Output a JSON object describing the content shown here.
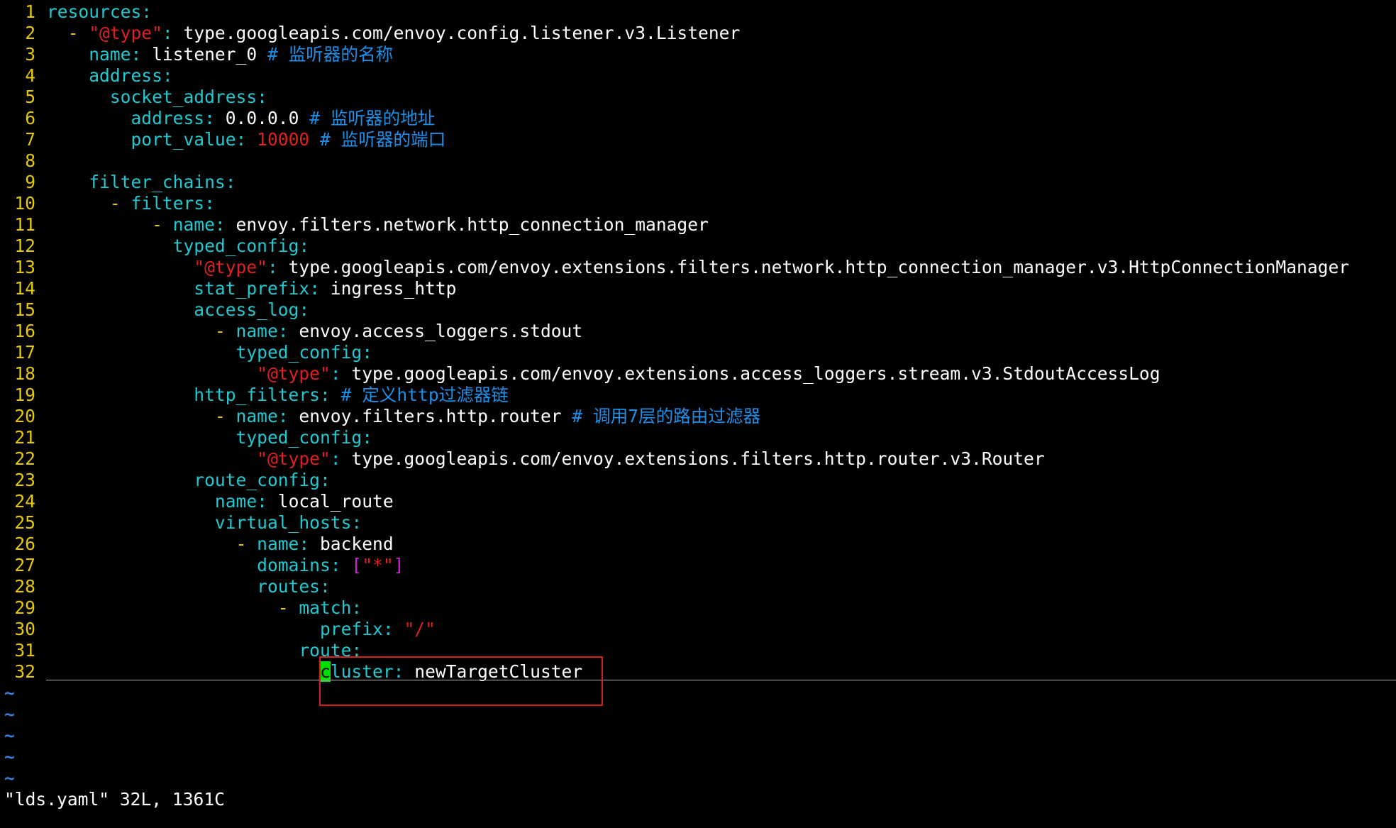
{
  "editor": {
    "lines": [
      {
        "num": "1",
        "parts": [
          {
            "t": "resources",
            "c": "key"
          },
          {
            "t": ":",
            "c": "punc"
          }
        ]
      },
      {
        "num": "2",
        "parts": [
          {
            "t": "  - ",
            "c": "dash"
          },
          {
            "t": "\"@type\"",
            "c": "str"
          },
          {
            "t": ": ",
            "c": "punc"
          },
          {
            "t": "type.googleapis.com/envoy.config.listener.v3.Listener",
            "c": "val"
          }
        ]
      },
      {
        "num": "3",
        "parts": [
          {
            "t": "    name",
            "c": "key"
          },
          {
            "t": ": ",
            "c": "punc"
          },
          {
            "t": "listener_0 ",
            "c": "val"
          },
          {
            "t": "# 监听器的名称",
            "c": "cmt"
          }
        ]
      },
      {
        "num": "4",
        "parts": [
          {
            "t": "    address",
            "c": "key"
          },
          {
            "t": ":",
            "c": "punc"
          }
        ]
      },
      {
        "num": "5",
        "parts": [
          {
            "t": "      socket_address",
            "c": "key"
          },
          {
            "t": ":",
            "c": "punc"
          }
        ]
      },
      {
        "num": "6",
        "parts": [
          {
            "t": "        address",
            "c": "key"
          },
          {
            "t": ": ",
            "c": "punc"
          },
          {
            "t": "0.0.0.0 ",
            "c": "val"
          },
          {
            "t": "# 监听器的地址",
            "c": "cmt"
          }
        ]
      },
      {
        "num": "7",
        "parts": [
          {
            "t": "        port_value",
            "c": "key"
          },
          {
            "t": ": ",
            "c": "punc"
          },
          {
            "t": "10000",
            "c": "num"
          },
          {
            "t": " ",
            "c": "val"
          },
          {
            "t": "# 监听器的端口",
            "c": "cmt"
          }
        ]
      },
      {
        "num": "8",
        "parts": []
      },
      {
        "num": "9",
        "parts": [
          {
            "t": "    filter_chains",
            "c": "key"
          },
          {
            "t": ":",
            "c": "punc"
          }
        ]
      },
      {
        "num": "10",
        "parts": [
          {
            "t": "      - ",
            "c": "dash"
          },
          {
            "t": "filters",
            "c": "key"
          },
          {
            "t": ":",
            "c": "punc"
          }
        ]
      },
      {
        "num": "11",
        "parts": [
          {
            "t": "          - ",
            "c": "dash"
          },
          {
            "t": "name",
            "c": "key"
          },
          {
            "t": ": ",
            "c": "punc"
          },
          {
            "t": "envoy.filters.network.http_connection_manager",
            "c": "val"
          }
        ]
      },
      {
        "num": "12",
        "parts": [
          {
            "t": "            typed_config",
            "c": "key"
          },
          {
            "t": ":",
            "c": "punc"
          }
        ]
      },
      {
        "num": "13",
        "parts": [
          {
            "t": "              ",
            "c": "val"
          },
          {
            "t": "\"@type\"",
            "c": "str"
          },
          {
            "t": ": ",
            "c": "punc"
          },
          {
            "t": "type.googleapis.com/envoy.extensions.filters.network.http_connection_manager.v3.HttpConnectionManager",
            "c": "val"
          }
        ]
      },
      {
        "num": "14",
        "parts": [
          {
            "t": "              stat_prefix",
            "c": "key"
          },
          {
            "t": ": ",
            "c": "punc"
          },
          {
            "t": "ingress_http",
            "c": "val"
          }
        ]
      },
      {
        "num": "15",
        "parts": [
          {
            "t": "              access_log",
            "c": "key"
          },
          {
            "t": ":",
            "c": "punc"
          }
        ]
      },
      {
        "num": "16",
        "parts": [
          {
            "t": "                - ",
            "c": "dash"
          },
          {
            "t": "name",
            "c": "key"
          },
          {
            "t": ": ",
            "c": "punc"
          },
          {
            "t": "envoy.access_loggers.stdout",
            "c": "val"
          }
        ]
      },
      {
        "num": "17",
        "parts": [
          {
            "t": "                  typed_config",
            "c": "key"
          },
          {
            "t": ":",
            "c": "punc"
          }
        ]
      },
      {
        "num": "18",
        "parts": [
          {
            "t": "                    ",
            "c": "val"
          },
          {
            "t": "\"@type\"",
            "c": "str"
          },
          {
            "t": ": ",
            "c": "punc"
          },
          {
            "t": "type.googleapis.com/envoy.extensions.access_loggers.stream.v3.StdoutAccessLog",
            "c": "val"
          }
        ]
      },
      {
        "num": "19",
        "parts": [
          {
            "t": "              http_filters",
            "c": "key"
          },
          {
            "t": ": ",
            "c": "punc"
          },
          {
            "t": "# 定义http过滤器链",
            "c": "cmt"
          }
        ]
      },
      {
        "num": "20",
        "parts": [
          {
            "t": "                - ",
            "c": "dash"
          },
          {
            "t": "name",
            "c": "key"
          },
          {
            "t": ": ",
            "c": "punc"
          },
          {
            "t": "envoy.filters.http.router ",
            "c": "val"
          },
          {
            "t": "# 调用7层的路由过滤器",
            "c": "cmt"
          }
        ]
      },
      {
        "num": "21",
        "parts": [
          {
            "t": "                  typed_config",
            "c": "key"
          },
          {
            "t": ":",
            "c": "punc"
          }
        ]
      },
      {
        "num": "22",
        "parts": [
          {
            "t": "                    ",
            "c": "val"
          },
          {
            "t": "\"@type\"",
            "c": "str"
          },
          {
            "t": ": ",
            "c": "punc"
          },
          {
            "t": "type.googleapis.com/envoy.extensions.filters.http.router.v3.Router",
            "c": "val"
          }
        ]
      },
      {
        "num": "23",
        "parts": [
          {
            "t": "              route_config",
            "c": "key"
          },
          {
            "t": ":",
            "c": "punc"
          }
        ]
      },
      {
        "num": "24",
        "parts": [
          {
            "t": "                name",
            "c": "key"
          },
          {
            "t": ": ",
            "c": "punc"
          },
          {
            "t": "local_route",
            "c": "val"
          }
        ]
      },
      {
        "num": "25",
        "parts": [
          {
            "t": "                virtual_hosts",
            "c": "key"
          },
          {
            "t": ":",
            "c": "punc"
          }
        ]
      },
      {
        "num": "26",
        "parts": [
          {
            "t": "                  - ",
            "c": "dash"
          },
          {
            "t": "name",
            "c": "key"
          },
          {
            "t": ": ",
            "c": "punc"
          },
          {
            "t": "backend",
            "c": "val"
          }
        ]
      },
      {
        "num": "27",
        "parts": [
          {
            "t": "                    domains",
            "c": "key"
          },
          {
            "t": ": ",
            "c": "punc"
          },
          {
            "t": "[",
            "c": "magenta"
          },
          {
            "t": "\"*\"",
            "c": "str"
          },
          {
            "t": "]",
            "c": "magenta"
          }
        ]
      },
      {
        "num": "28",
        "parts": [
          {
            "t": "                    routes",
            "c": "key"
          },
          {
            "t": ":",
            "c": "punc"
          }
        ]
      },
      {
        "num": "29",
        "parts": [
          {
            "t": "                      - ",
            "c": "dash"
          },
          {
            "t": "match",
            "c": "key"
          },
          {
            "t": ":",
            "c": "punc"
          }
        ]
      },
      {
        "num": "30",
        "parts": [
          {
            "t": "                          prefix",
            "c": "key"
          },
          {
            "t": ": ",
            "c": "punc"
          },
          {
            "t": "\"/\"",
            "c": "str"
          }
        ]
      },
      {
        "num": "31",
        "parts": [
          {
            "t": "                        route",
            "c": "key"
          },
          {
            "t": ":",
            "c": "punc"
          }
        ]
      },
      {
        "num": "32",
        "parts": [
          {
            "t": "                          ",
            "c": "val"
          },
          {
            "t": "c",
            "c": "cursor"
          },
          {
            "t": "luster",
            "c": "key"
          },
          {
            "t": ": ",
            "c": "punc"
          },
          {
            "t": "newTargetCluster",
            "c": "val"
          }
        ]
      }
    ],
    "empty_line_marker": "~",
    "empty_line_count": 5
  },
  "statusbar": {
    "message": "\"lds.yaml\" 32L, 1361C"
  },
  "colors": {
    "background": "#000000",
    "line_number": "#e6c800",
    "key": "#20c8d0",
    "string": "#e02020",
    "comment": "#1c8fe8",
    "bracket": "#d020d0",
    "cursor": "#00e000",
    "annotation_box": "#d81e1e"
  }
}
